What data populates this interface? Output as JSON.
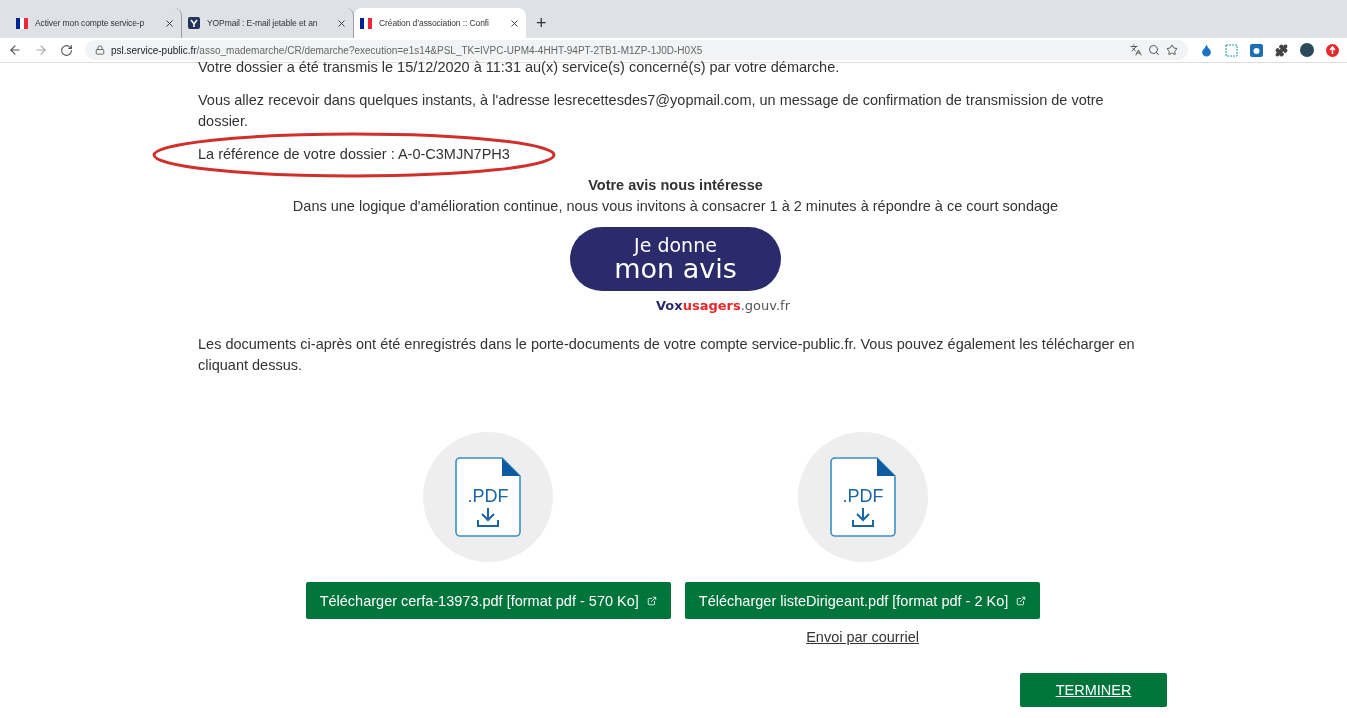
{
  "browser": {
    "tabs": [
      {
        "title": "Activer mon compte service-p",
        "selected": false
      },
      {
        "title": "YOPmail : E-mail jetable et an",
        "selected": false
      },
      {
        "title": "Création d’association :: Confi",
        "selected": true
      }
    ],
    "new_tab": "+",
    "url_host": "psl.service-public.fr",
    "url_path": "/asso_mademarche/CR/demarche?execution=e1s14&PSL_TK=IVPC-UPM4-4HHT-94PT-2TB1-M1ZP-1J0D-H0X5"
  },
  "page": {
    "transmitted": "Votre dossier a été transmis le 15/12/2020 à 11:31 au(x) service(s) concerné(s) par votre démarche.",
    "confirmation": "Vous allez recevoir dans quelques instants, à l'adresse lesrecettesdes7@yopmail.com, un message de confirmation de transmission de votre dossier.",
    "reference": "La référence de votre dossier : A-0-C3MJN7PH3",
    "survey_title": "Votre avis nous intéresse",
    "survey_text": "Dans une logique d'amélioration continue, nous vous invitons à consacrer 1 à 2 minutes à répondre à ce court sondage",
    "survey_button": [
      "Je donne",
      "mon avis"
    ],
    "survey_brand": [
      "Vox",
      "usagers",
      ".gouv.fr"
    ],
    "documents_text": "Les documents ci-après ont été enregistrés dans le porte-documents de votre compte service-public.fr. Vous pouvez également les télécharger en cliquant dessus.",
    "documents": [
      {
        "icon_label": ".PDF",
        "button": "Télécharger cerfa-13973.pdf [format pdf - 570 Ko]"
      },
      {
        "icon_label": ".PDF",
        "button": "Télécharger listeDirigeant.pdf [format pdf - 2 Ko]",
        "link": "Envoi par courriel"
      }
    ],
    "finish": "TERMINER"
  }
}
